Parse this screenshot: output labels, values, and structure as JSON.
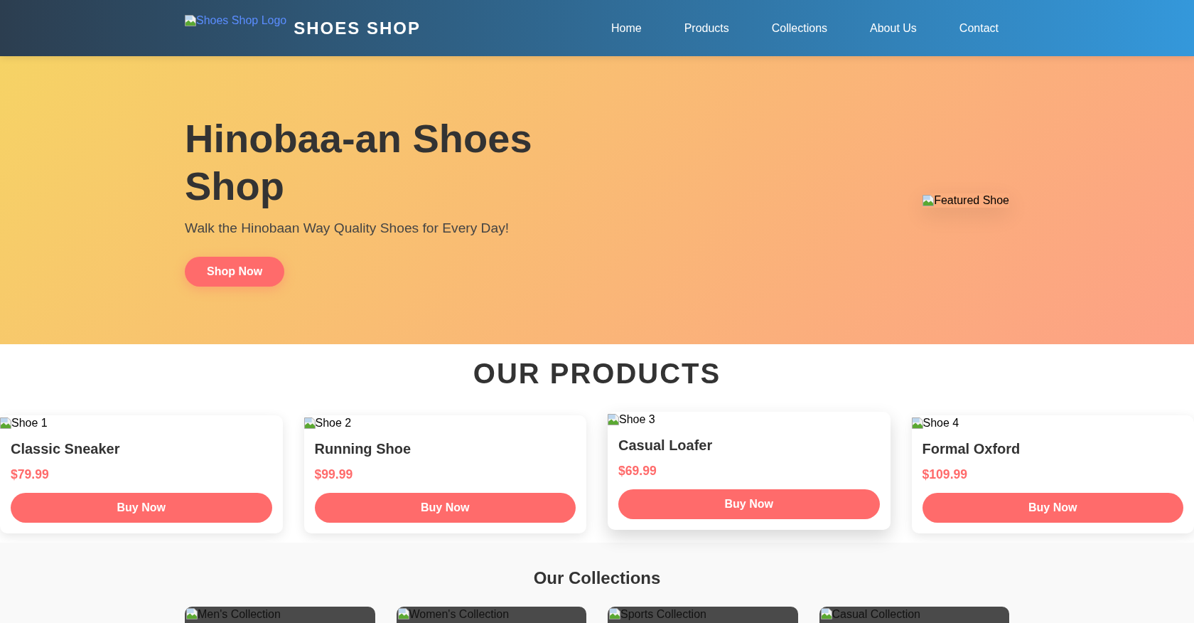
{
  "header": {
    "logo_alt": "Shoes Shop Logo",
    "brand": "SHOES SHOP",
    "nav": [
      "Home",
      "Products",
      "Collections",
      "About Us",
      "Contact"
    ]
  },
  "hero": {
    "title": "Hinobaa-an Shoes Shop",
    "subtitle": "Walk the Hinobaan Way Quality Shoes for Every Day!",
    "button": "Shop Now",
    "image_alt": "Featured Shoe"
  },
  "products": {
    "title": "OUR PRODUCTS",
    "items": [
      {
        "image_alt": "Shoe 1",
        "name": "Classic Sneaker",
        "price": "$79.99",
        "button": "Buy Now",
        "hovered": false
      },
      {
        "image_alt": "Shoe 2",
        "name": "Running Shoe",
        "price": "$99.99",
        "button": "Buy Now",
        "hovered": false
      },
      {
        "image_alt": "Shoe 3",
        "name": "Casual Loafer",
        "price": "$69.99",
        "button": "Buy Now",
        "hovered": true
      },
      {
        "image_alt": "Shoe 4",
        "name": "Formal Oxford",
        "price": "$109.99",
        "button": "Buy Now",
        "hovered": false
      }
    ]
  },
  "collections": {
    "title": "Our Collections",
    "items": [
      {
        "image_alt": "Men's Collection"
      },
      {
        "image_alt": "Women's Collection"
      },
      {
        "image_alt": "Sports Collection"
      },
      {
        "image_alt": "Casual Collection"
      }
    ]
  }
}
